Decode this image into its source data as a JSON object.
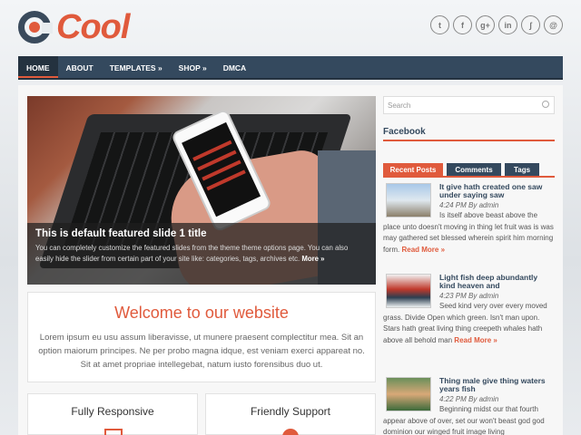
{
  "logo": {
    "text": "Cool"
  },
  "social": [
    {
      "icon": "twitter-icon",
      "glyph": "t"
    },
    {
      "icon": "facebook-icon",
      "glyph": "f"
    },
    {
      "icon": "google-plus-icon",
      "glyph": "g+"
    },
    {
      "icon": "linkedin-icon",
      "glyph": "in"
    },
    {
      "icon": "rss-icon",
      "glyph": "ʃ"
    },
    {
      "icon": "email-icon",
      "glyph": "@"
    }
  ],
  "nav": [
    "HOME",
    "ABOUT",
    "TEMPLATES »",
    "SHOP »",
    "DMCA"
  ],
  "slider": {
    "title": "This is default featured slide 1 title",
    "desc": "You can completely customize the featured slides from the theme theme options page. You can also easily hide the slider from certain part of your site like: categories, tags, archives etc.",
    "more": "More »"
  },
  "welcome": {
    "title": "Welcome to our website",
    "text": "Lorem ipsum eu usu assum liberavisse, ut munere praesent complectitur mea. Sit an option maiorum principes. Ne per probo magna idque, est veniam exerci appareat no. Sit at amet propriae intellegebat, natum iusto forensibus duo ut."
  },
  "features": [
    "Fully Responsive",
    "Friendly Support"
  ],
  "sidebar": {
    "search_placeholder": "Search",
    "facebook_title": "Facebook",
    "tabs": [
      "Recent Posts",
      "Comments",
      "Tags"
    ],
    "posts": [
      {
        "title": "It give hath created one saw under saying saw",
        "meta": "4:24 PM By admin",
        "excerpt": "Is itself above beast above the place unto doesn't moving in thing let fruit was is was may gathered set blessed wherein spirit him morning form.",
        "more": "Read More »"
      },
      {
        "title": "Light fish deep abundantly kind heaven and",
        "meta": "4:23 PM By admin",
        "excerpt": "Seed kind very over every moved grass. Divide Open which green. Isn't man upon. Stars hath great living thing creepeth whales hath above all behold man",
        "more": "Read More »"
      },
      {
        "title": "Thing male give thing waters years fish",
        "meta": "4:22 PM By admin",
        "excerpt": "Beginning midst our that fourth appear above of over, set our won't beast god god dominion our winged fruit image living",
        "more": ""
      }
    ]
  },
  "colors": {
    "accent": "#e05a3c",
    "nav": "#34495e"
  }
}
